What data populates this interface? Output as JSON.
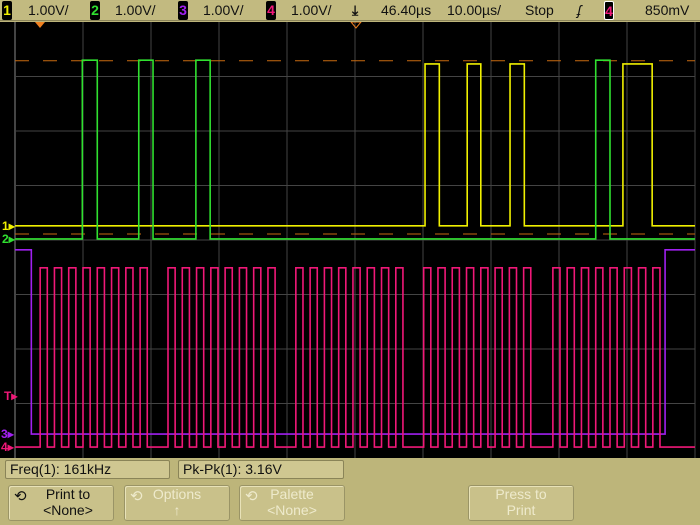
{
  "header": {
    "ch1": {
      "num": "1",
      "scale": "1.00V/",
      "color": "#f0f000"
    },
    "ch2": {
      "num": "2",
      "scale": "1.00V/",
      "color": "#30e030"
    },
    "ch3": {
      "num": "3",
      "scale": "1.00V/",
      "color": "#a020f0"
    },
    "ch4": {
      "num": "4",
      "scale": "1.00V/",
      "color": "#f01878"
    },
    "delay": "46.40µs",
    "timebase": "10.00µs/",
    "run_state": "Stop",
    "trigger_slope_icon": "rising-edge-icon",
    "trigger_source": "4",
    "trigger_level": "850mV"
  },
  "markers": {
    "ch1": "1",
    "ch2": "2",
    "ch3": "3",
    "ch4": "4",
    "trigger": "T"
  },
  "measurements": [
    {
      "label": "Freq(1): 161kHz"
    },
    {
      "label": "Pk-Pk(1): 3.16V"
    }
  ],
  "softkeys": [
    {
      "line1": "Print to",
      "line2": "<None>",
      "icon": "rotate-knob-icon",
      "enabled": true
    },
    {
      "line1": "Options",
      "line2": "↑",
      "icon": "rotate-knob-icon",
      "enabled": false
    },
    {
      "line1": "Palette",
      "line2": "<None>",
      "icon": "rotate-knob-icon",
      "enabled": false
    },
    {
      "line1": "Press to",
      "line2": "Print",
      "enabled": false
    }
  ],
  "chart_data": {
    "type": "line",
    "x_unit": "µs from left edge of screen",
    "y_unit": "V relative to screen center",
    "x_range": [
      0,
      100
    ],
    "y_range": [
      -4,
      4
    ],
    "grid": true,
    "trigger_level_lines_V": [
      3.29,
      0.11
    ],
    "channels": [
      {
        "name": "1",
        "color": "#f0f000",
        "high": 3.23,
        "low": 0.26,
        "initial": "low",
        "pulses": [
          [
            60.3,
            62.4
          ],
          [
            66.5,
            68.5
          ],
          [
            72.8,
            74.9
          ],
          [
            89.4,
            93.7
          ]
        ]
      },
      {
        "name": "2",
        "color": "#30e030",
        "high": 3.3,
        "low": 0.02,
        "initial": "low",
        "pulses": [
          [
            9.9,
            12.1
          ],
          [
            18.2,
            20.3
          ],
          [
            26.6,
            28.7
          ],
          [
            85.4,
            87.5
          ]
        ]
      },
      {
        "name": "3",
        "color": "#a020f0",
        "high": -0.18,
        "low": -3.56,
        "initial": "high",
        "edges": [
          2.4,
          95.6
        ]
      },
      {
        "name": "4",
        "color": "#f01878",
        "high": -0.51,
        "low": -3.8,
        "initial": "low",
        "bursts": [
          0.37,
          2.25,
          4.13,
          6.01,
          7.91
        ],
        "burst_unit_div": true,
        "pulses_per_burst": 8,
        "pulse_period_us": 2.1,
        "pulse_width_us": 1.05
      }
    ]
  }
}
